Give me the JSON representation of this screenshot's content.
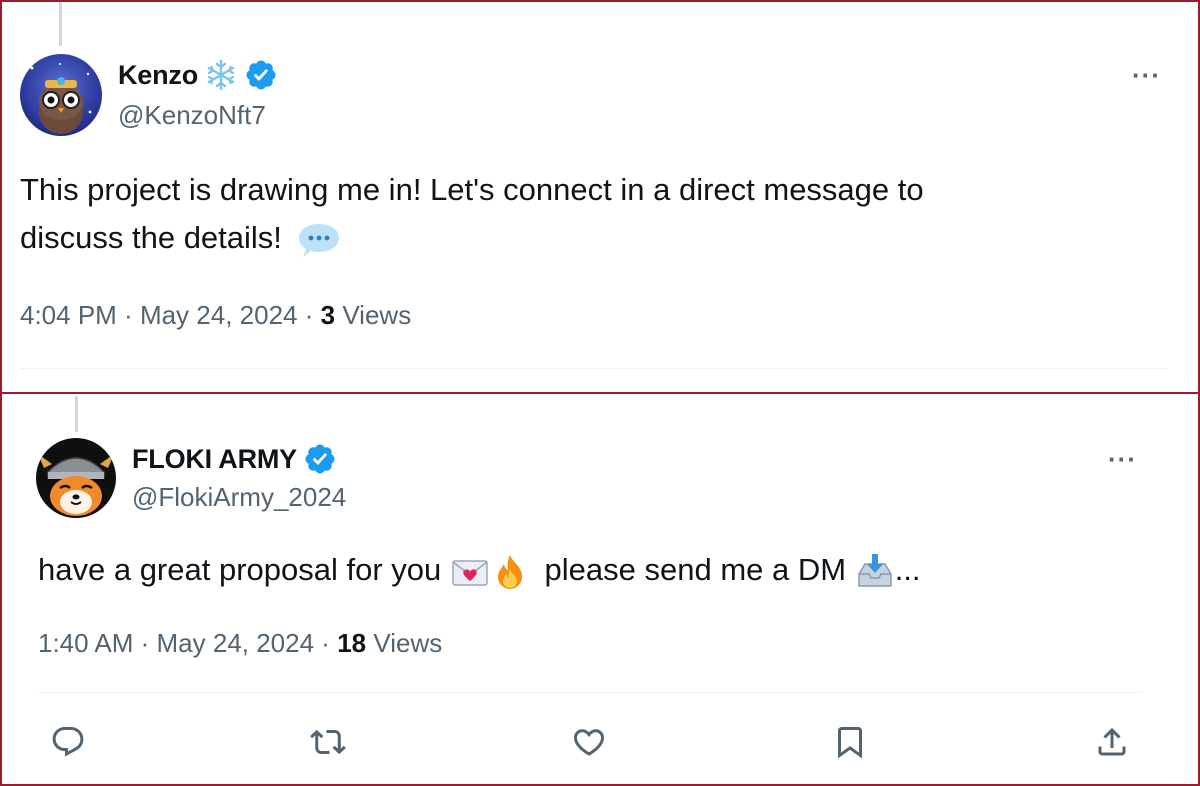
{
  "tweet1": {
    "display_name": "Kenzo",
    "handle": "@KenzoNft7",
    "text_line1": "This project is drawing me in! Let's connect in a direct message to",
    "text_line2": "discuss the details!",
    "time": "4:04 PM",
    "sep1": " · ",
    "date": "May 24, 2024",
    "sep2": " · ",
    "views_count": "3",
    "views_label": "Views",
    "more_label": "···",
    "name_emoji_icon": "snowflake-icon",
    "text_emoji_icon": "speech-bubble-icon"
  },
  "tweet2": {
    "display_name": "FLOKI ARMY",
    "handle": "@FlokiArmy_2024",
    "text_part1": "have a great proposal for you",
    "text_part2": "please send me a DM",
    "text_part3": "...",
    "time": "1:40 AM",
    "sep1": " · ",
    "date": "May 24, 2024",
    "sep2": " · ",
    "views_count": "18",
    "views_label": "Views",
    "more_label": "···",
    "emoji_icons": [
      "love-letter-icon",
      "fire-icon",
      "inbox-tray-icon"
    ]
  },
  "actions": [
    "reply-icon",
    "retweet-icon",
    "like-icon",
    "bookmark-icon",
    "share-icon"
  ],
  "colors": {
    "border": "#9b1c31",
    "verified": "#1d9bf0",
    "muted_text": "#536471",
    "primary_text": "#0f1419",
    "divider": "#eff3f4"
  }
}
